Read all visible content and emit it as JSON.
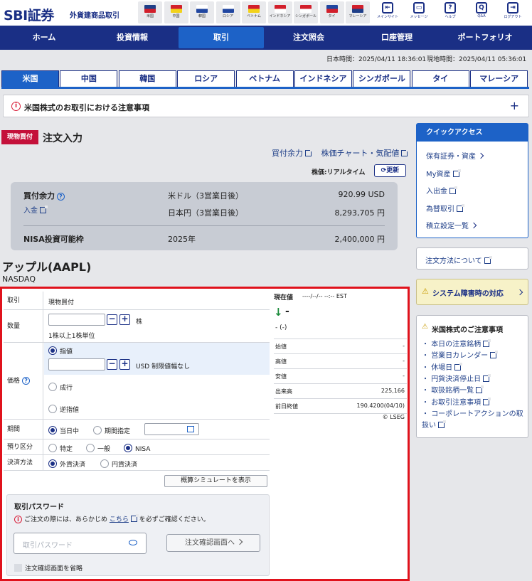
{
  "header": {
    "logo": "SBI証券",
    "subtitle": "外貨建商品取引",
    "flags": [
      {
        "label": "米国",
        "c1": "#1f3f88",
        "c2": "#d21f2b"
      },
      {
        "label": "中国",
        "c1": "#d21f2b",
        "c2": "#f2d21b"
      },
      {
        "label": "韓国",
        "c1": "#ffffff",
        "c2": "#2046a0"
      },
      {
        "label": "ロシア",
        "c1": "#ffffff",
        "c2": "#2046a0"
      },
      {
        "label": "ベトナム",
        "c1": "#d21f2b",
        "c2": "#f2d21b"
      },
      {
        "label": "インドネシア",
        "c1": "#d21f2b",
        "c2": "#ffffff"
      },
      {
        "label": "シンガポール",
        "c1": "#d21f2b",
        "c2": "#ffffff"
      },
      {
        "label": "タイ",
        "c1": "#2046a0",
        "c2": "#d21f2b"
      },
      {
        "label": "マレーシア",
        "c1": "#d21f2b",
        "c2": "#1f3f88"
      }
    ],
    "icons": [
      {
        "name": "message-site-icon",
        "label": "メインサイト",
        "glyph": "⇤"
      },
      {
        "name": "message-icon",
        "label": "メッセージ",
        "glyph": "▭"
      },
      {
        "name": "help-icon",
        "label": "ヘルプ",
        "glyph": "?"
      },
      {
        "name": "qa-icon",
        "label": "Q&A",
        "glyph": "Q"
      },
      {
        "name": "logout-icon",
        "label": "ログアウト",
        "glyph": "⇥"
      }
    ]
  },
  "nav": {
    "items": [
      "ホーム",
      "投資情報",
      "取引",
      "注文照会",
      "口座管理",
      "ポートフォリオ"
    ]
  },
  "time": {
    "japan": "日本時間：2025/04/11 18:36:01",
    "local": "現地時間：2025/04/11 05:36:01"
  },
  "markets": [
    "米国",
    "中国",
    "韓国",
    "ロシア",
    "ベトナム",
    "インドネシア",
    "シンガポール",
    "タイ",
    "マレーシア"
  ],
  "notice": "米国株式のお取引における注意事項",
  "order": {
    "badge": "現物買付",
    "title": "注文入力",
    "link1": "買付余力",
    "link2": "株価チャート・気配値",
    "price_mode": "株価:リアルタイム",
    "refresh": "更新"
  },
  "summary": {
    "buying_power_label": "買付余力",
    "deposit_link": "入金",
    "usd_label": "米ドル（3営業日後）",
    "usd_value": "920.99 USD",
    "jpy_label": "日本円（3営業日後）",
    "jpy_value": "8,293,705 円",
    "nisa_label": "NISA投資可能枠",
    "nisa_year": "2025年",
    "nisa_value": "2,400,000 円"
  },
  "stock": {
    "name": "アップル(AAPL)",
    "exchange": "NASDAQ"
  },
  "form": {
    "trade_label": "取引",
    "trade_value": "現物買付",
    "qty_label": "数量",
    "qty_unit": "株",
    "qty_note": "1株以上1株単位",
    "price_label": "価格",
    "limit": "指値",
    "limit_note": "USD 制限値幅なし",
    "market": "成行",
    "stop": "逆指値",
    "period_label": "期間",
    "today": "当日中",
    "period_specify": "期間指定",
    "account_label": "預り区分",
    "acc_specific": "特定",
    "acc_general": "一般",
    "acc_nisa": "NISA",
    "settle_label": "決済方法",
    "settle_fx": "外貨決済",
    "settle_jpy": "円貨決済",
    "simulate": "概算シミュレートを表示",
    "pw_title": "取引パスワード",
    "pw_note_pre": "ご注文の際には、あらかじめ",
    "pw_note_link": "こちら",
    "pw_note_post": "を必ずご確認ください。",
    "pw_placeholder": "取引パスワード",
    "confirm_button": "注文確認画面へ",
    "skip_confirm": "注文確認画面を省略"
  },
  "quote": {
    "current_label": "現在値",
    "current_time": "----/--/-- --:-- EST",
    "price": "-",
    "change": "- (-)",
    "rows": [
      {
        "k": "始値",
        "v": "-"
      },
      {
        "k": "高値",
        "v": "-"
      },
      {
        "k": "安値",
        "v": "-"
      },
      {
        "k": "出来高",
        "v": "225,166"
      },
      {
        "k": "前日終値",
        "v": "190.4200(04/10)"
      }
    ],
    "credit": "© LSEG"
  },
  "sidebar": {
    "quick_title": "クイックアクセス",
    "quick_links": [
      "保有証券・資産",
      "My資産",
      "入出金",
      "為替取引",
      "積立設定一覧"
    ],
    "order_method": "注文方法について",
    "system_trouble": "システム障害時の対応",
    "us_notice_title": "米国株式のご注意事項",
    "us_links": [
      "本日の注意銘柄",
      "営業日カレンダー",
      "休場日",
      "円貨決済停止日",
      "取扱銘柄一覧",
      "お取引注意事項",
      "コーポレートアクションの取扱い"
    ]
  }
}
